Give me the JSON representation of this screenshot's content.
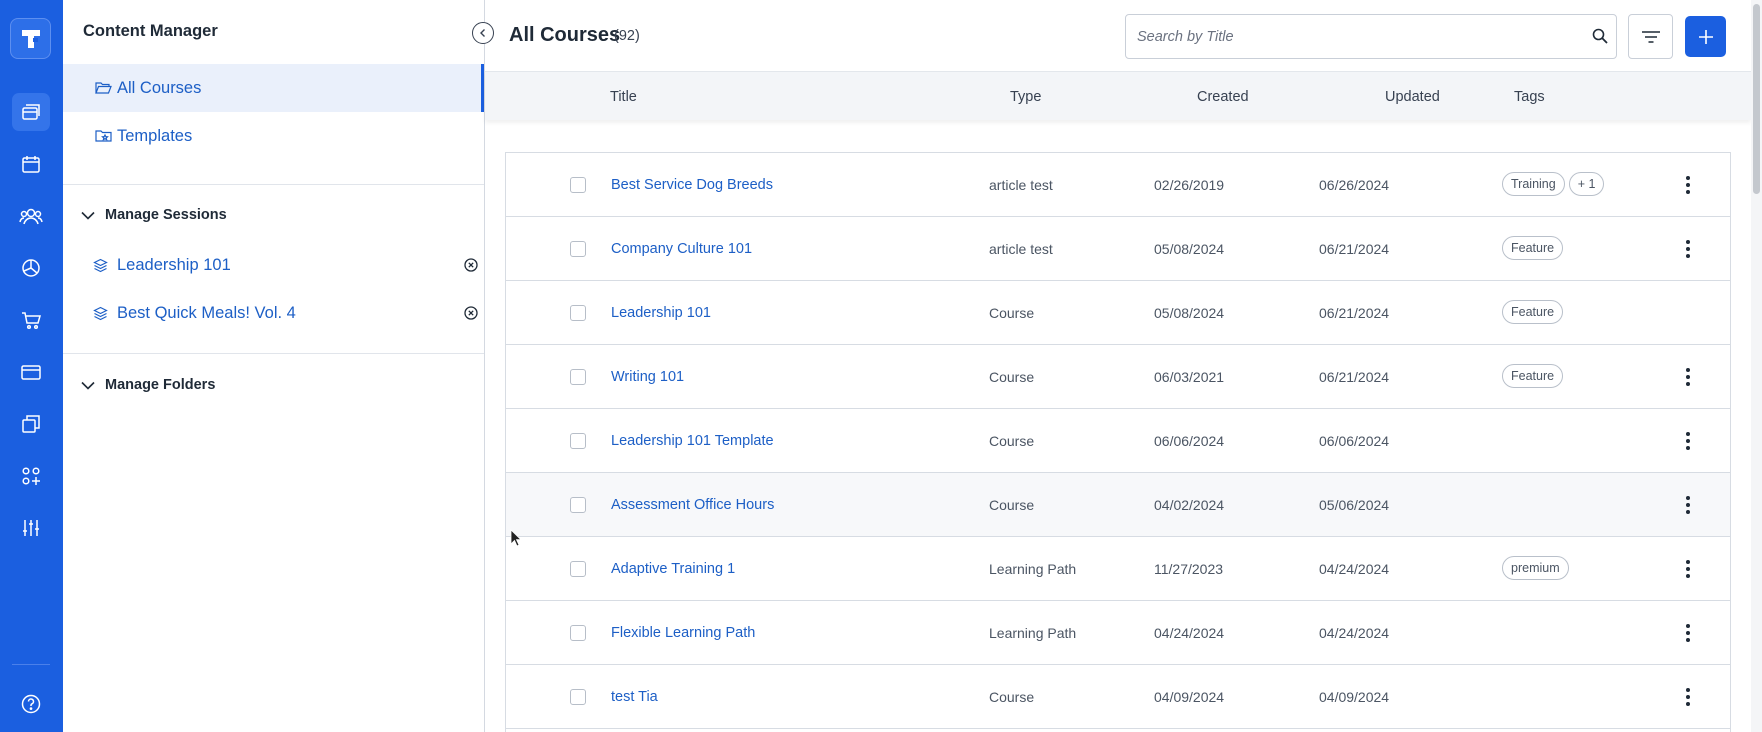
{
  "rail": {
    "icons": [
      "logo-icon",
      "courses-icon",
      "calendar-icon",
      "users-icon",
      "reports-icon",
      "cart-icon",
      "card-icon",
      "copy-icon",
      "apps-icon",
      "sliders-icon",
      "help-icon"
    ],
    "accent": "#1b5fe0"
  },
  "sidebar": {
    "title": "Content Manager",
    "nav": [
      {
        "label": "All Courses",
        "icon": "folder-open-icon",
        "active": true
      },
      {
        "label": "Templates",
        "icon": "folder-star-icon",
        "active": false
      }
    ],
    "sessions_header": "Manage Sessions",
    "sessions": [
      {
        "label": "Leadership 101",
        "icon": "layers-icon"
      },
      {
        "label": "Best Quick Meals! Vol. 4",
        "icon": "layers-icon"
      }
    ],
    "folders_header": "Manage Folders"
  },
  "main": {
    "title": "All Courses",
    "count": "(92)",
    "search_placeholder": "Search by Title",
    "columns": [
      "Title",
      "Type",
      "Created",
      "Updated",
      "Tags"
    ],
    "rows": [
      {
        "title": "Best Service Dog Breeds",
        "type": "article test",
        "created": "02/26/2019",
        "updated": "06/26/2024",
        "tags": [
          "Training",
          "+ 1"
        ],
        "menu": true
      },
      {
        "title": "Company Culture 101",
        "type": "article test",
        "created": "05/08/2024",
        "updated": "06/21/2024",
        "tags": [
          "Feature"
        ],
        "menu": true
      },
      {
        "title": "Leadership 101",
        "type": "Course",
        "created": "05/08/2024",
        "updated": "06/21/2024",
        "tags": [
          "Feature"
        ],
        "menu": false
      },
      {
        "title": "Writing 101",
        "type": "Course",
        "created": "06/03/2021",
        "updated": "06/21/2024",
        "tags": [
          "Feature"
        ],
        "menu": true
      },
      {
        "title": "Leadership 101 Template",
        "type": "Course",
        "created": "06/06/2024",
        "updated": "06/06/2024",
        "tags": [],
        "menu": true
      },
      {
        "title": "Assessment Office Hours",
        "type": "Course",
        "created": "04/02/2024",
        "updated": "05/06/2024",
        "tags": [],
        "menu": true,
        "hover": true
      },
      {
        "title": "Adaptive Training 1",
        "type": "Learning Path",
        "created": "11/27/2023",
        "updated": "04/24/2024",
        "tags": [
          "premium"
        ],
        "menu": true
      },
      {
        "title": "Flexible Learning Path",
        "type": "Learning Path",
        "created": "04/24/2024",
        "updated": "04/24/2024",
        "tags": [],
        "menu": true
      },
      {
        "title": "test Tia",
        "type": "Course",
        "created": "04/09/2024",
        "updated": "04/09/2024",
        "tags": [],
        "menu": true
      }
    ]
  }
}
